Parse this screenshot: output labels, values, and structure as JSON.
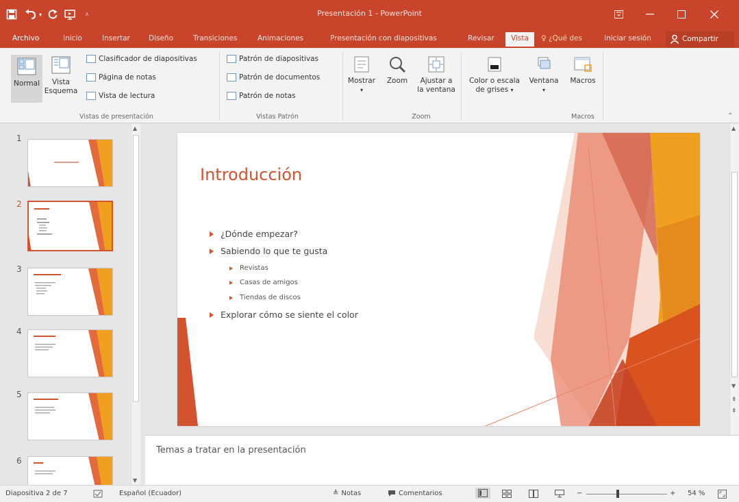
{
  "window": {
    "title": "Presentación 1 - PowerPoint"
  },
  "quick_access": {
    "save_icon": "save-icon",
    "undo_icon": "undo-icon",
    "redo_icon": "redo-icon",
    "start_icon": "start-from-beginning-icon",
    "customize_icon": "customize-qat-icon"
  },
  "tabs": [
    {
      "label": "Archivo"
    },
    {
      "label": "Inicio"
    },
    {
      "label": "Insertar"
    },
    {
      "label": "Diseño"
    },
    {
      "label": "Transiciones"
    },
    {
      "label": "Animaciones"
    },
    {
      "label": "Presentación con diapositivas"
    },
    {
      "label": "Revisar"
    },
    {
      "label": "Vista"
    }
  ],
  "tell_me": "¿Qué des",
  "sign_in": "Iniciar sesión",
  "share": "Compartir",
  "ribbon": {
    "normal": "Normal",
    "outline_1": "Vista",
    "outline_2": "Esquema",
    "slide_sorter": "Clasificador de diapositivas",
    "notes_page": "Página de notas",
    "reading_view": "Vista de lectura",
    "group_presentation_views": "Vistas de presentación",
    "slide_master": "Patrón de diapositivas",
    "handout_master": "Patrón de documentos",
    "notes_master": "Patrón de notas",
    "group_master_views": "Vistas Patrón",
    "show": "Mostrar",
    "zoom": "Zoom",
    "fit_1": "Ajustar a",
    "fit_2": "la ventana",
    "group_zoom": "Zoom",
    "color_1": "Color o escala",
    "color_2": "de grises",
    "window": "Ventana",
    "macros": "Macros",
    "group_macros": "Macros"
  },
  "thumbnails": [
    {
      "number": "1"
    },
    {
      "number": "2"
    },
    {
      "number": "3"
    },
    {
      "number": "4"
    },
    {
      "number": "5"
    },
    {
      "number": "6"
    }
  ],
  "slide": {
    "title": "Introducción",
    "bullets": [
      "¿Dónde empezar?",
      "Sabiendo lo que te gusta",
      "Explorar cómo se siente el color"
    ],
    "sub_bullets": [
      "Revistas",
      "Casas de amigos",
      "Tiendas de discos"
    ]
  },
  "notes": {
    "text": "Temas a tratar en la presentación"
  },
  "status": {
    "slide_count": "Diapositiva 2 de 7",
    "language": "Español (Ecuador)",
    "notes": "Notas",
    "comments": "Comentarios",
    "zoom": "54 %"
  },
  "colors": {
    "accent": "#c8452c",
    "slide_accent": "#d35230",
    "orange": "#f0a020"
  }
}
